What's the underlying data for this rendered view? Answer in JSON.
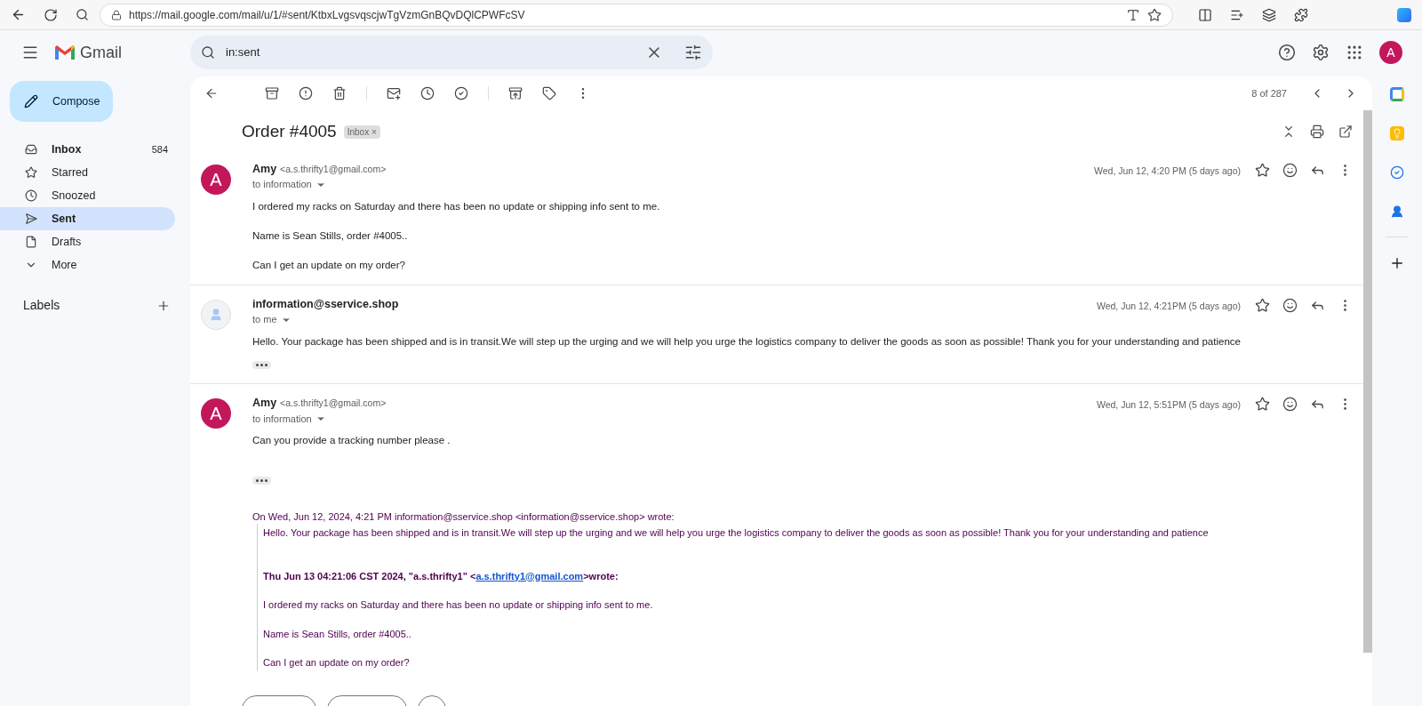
{
  "browser": {
    "url": "https://mail.google.com/mail/u/1/#sent/KtbxLvgsvqscjwTgVzmGnBQvDQlCPWFcSV"
  },
  "header": {
    "logo": "Gmail",
    "search": {
      "value": "in:sent"
    },
    "avatar": "A"
  },
  "compose": "Compose",
  "nav": [
    {
      "kind": "inbox",
      "label": "Inbox",
      "count": "584",
      "selected": false,
      "bold": true
    },
    {
      "kind": "star",
      "label": "Starred",
      "selected": false,
      "bold": false
    },
    {
      "kind": "clock",
      "label": "Snoozed",
      "selected": false,
      "bold": false
    },
    {
      "kind": "send",
      "label": "Sent",
      "selected": true,
      "bold": false
    },
    {
      "kind": "file",
      "label": "Drafts",
      "selected": false,
      "bold": false
    },
    {
      "kind": "more",
      "label": "More",
      "selected": false,
      "bold": false
    }
  ],
  "labels_heading": "Labels",
  "toolbar": {
    "counter": "8 of 287"
  },
  "thread": {
    "subject": "Order #4005",
    "label": "Inbox",
    "label_close": "×"
  },
  "messages": [
    {
      "kind": "letter",
      "avatar_letter": "A",
      "sender": "Amy",
      "email": "<a.s.thrifty1@gmail.com>",
      "to": "to information",
      "date": "Wed, Jun 12, 4:20 PM (5 days ago)",
      "body": [
        "I ordered my racks on Saturday and there has been no update or shipping info sent to me.",
        "Name is Sean Stills, order #4005..",
        "Can I get an update on my order?"
      ],
      "ellipsis": false
    },
    {
      "kind": "silhouette",
      "sender": "information@sservice.shop",
      "to": "to me",
      "date": "Wed, Jun 12, 4:21PM (5 days ago)",
      "body": [
        "Hello. Your package has been shipped and is in transit.We will step up the urging and we will help you urge the logistics company to deliver the goods as soon as possible! Thank you for your understanding and patience"
      ],
      "ellipsis": true
    },
    {
      "kind": "letter",
      "avatar_letter": "A",
      "sender": "Amy",
      "email": "<a.s.thrifty1@gmail.com>",
      "to": "to information",
      "date": "Wed, Jun 12, 5:51PM (5 days ago)",
      "body": [
        "Can you provide a tracking number please ."
      ],
      "ellipsis": true,
      "quote": {
        "attribution": "On Wed, Jun 12, 2024, 4:21 PM information@sservice.shop <information@sservice.shop> wrote:",
        "reply": "Hello. Your package has been shipped and is in transit.We will step up the urging and we will help you urge the logistics company to deliver the goods as soon as possible! Thank you for your understanding and patience",
        "nested_prefix": "Thu Jun 13 04:21:06 CST 2024,  \"a.s.thrifty1\" <",
        "nested_link": "a.s.thrifty1@gmail.com",
        "nested_suffix": ">wrote:",
        "nested_body": [
          "I ordered my racks on Saturday and there has been no update or shipping info sent to me.",
          "Name is Sean Stills, order #4005..",
          "Can I get an update on my order?"
        ]
      }
    }
  ]
}
